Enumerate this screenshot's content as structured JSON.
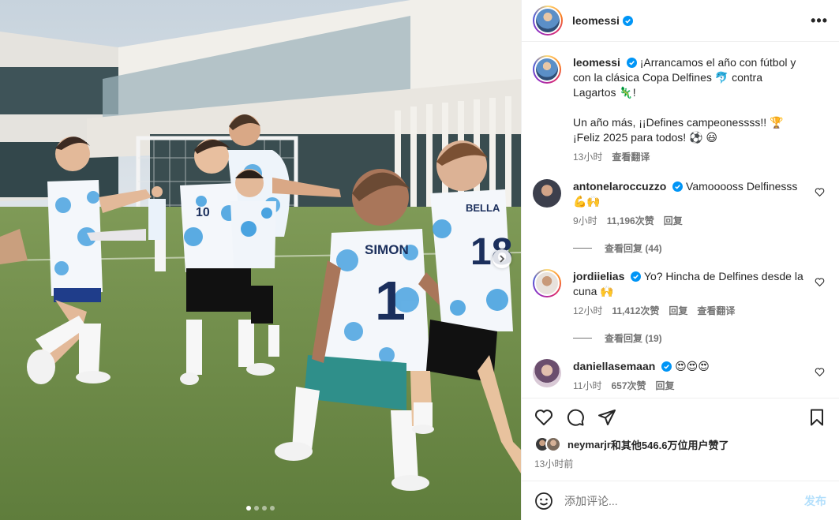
{
  "header": {
    "username": "leomessi",
    "more_icon": "more-horizontal-icon"
  },
  "caption": {
    "username": "leomessi",
    "text_line1": "¡Arrancamos el año con fútbol y con la clásica Copa Delfines 🐬 contra Lagartos 🦎!",
    "text_line2": "Un año más, ¡¡Defines campeonessss!! 🏆 ¡Feliz 2025 para todos! ⚽ 😃",
    "time": "13小时",
    "see_translation": "查看翻译"
  },
  "comments": [
    {
      "username": "antonelaroccuzzo",
      "text": "Vamooooss Delfinesss💪🙌",
      "time": "9小时",
      "likes": "11,196次赞",
      "reply": "回复",
      "view_replies": "查看回复 (44)"
    },
    {
      "username": "jordiielias",
      "text": "Yo? Hincha de Delfines desde la cuna 🙌",
      "time": "12小时",
      "likes": "11,412次赞",
      "reply": "回复",
      "see_translation": "查看翻译",
      "view_replies": "查看回复 (19)"
    },
    {
      "username": "daniellasemaan",
      "text": "😍😍😍",
      "time": "11小时",
      "likes": "657次赞",
      "reply": "回复"
    }
  ],
  "likes": {
    "text_user": "neymarjr",
    "text_rest": "和其他546.6万位用户赞了"
  },
  "post_time": "13小时前",
  "add_comment": {
    "placeholder": "添加评论...",
    "post_label": "发布",
    "emoji_icon": "emoji-icon"
  },
  "carousel": {
    "total": 4,
    "current": 1
  },
  "colors": {
    "verified": "#0095f6",
    "link_blue": "#b2dffc",
    "muted": "#737373"
  }
}
